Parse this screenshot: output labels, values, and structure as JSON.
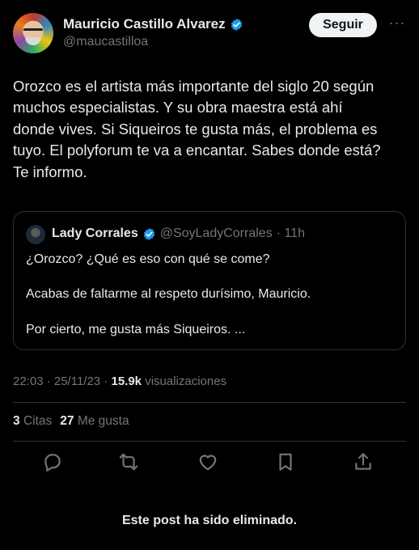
{
  "author": {
    "name": "Mauricio Castillo Alvarez",
    "handle": "@maucastilloa",
    "verified": true
  },
  "follow_label": "Seguir",
  "more_label": "···",
  "tweet": {
    "lines": [
      "Orozco es el artista más importante del siglo 20 según",
      "muchos especialistas. Y su obra maestra está ahí",
      "donde vives. Si Siqueiros te gusta más, el problema es",
      "tuyo. El polyforum te va a encantar. Sabes donde está?",
      "Te informo."
    ]
  },
  "quote": {
    "name": "Lady Corrales",
    "handle": "@SoyLadyCorrales",
    "time": "· 11h",
    "lines": [
      "¿Orozco? ¿Qué es eso con qué se come?",
      "Acabas de faltarme al respeto durísimo, Mauricio.",
      "Por cierto, me gusta más Siqueiros. ..."
    ]
  },
  "meta": {
    "time_date": "22:03 · 25/11/23 · ",
    "views_count": "15.9k",
    "views_label": " visualizaciones"
  },
  "stats": {
    "quotes_count": "3",
    "quotes_label": "Citas",
    "likes_count": "27",
    "likes_label": "Me gusta"
  },
  "icons": [
    "reply-icon",
    "retweet-icon",
    "like-icon",
    "bookmark-icon",
    "share-icon"
  ],
  "footer_notice": "Este post ha sido eliminado.",
  "colors": {
    "background": "#000000",
    "text": "#e7e9ea",
    "muted": "#71767b",
    "border": "#2f3336",
    "verified_blue": "#1d9bf0",
    "follow_bg": "#eff3f4"
  }
}
